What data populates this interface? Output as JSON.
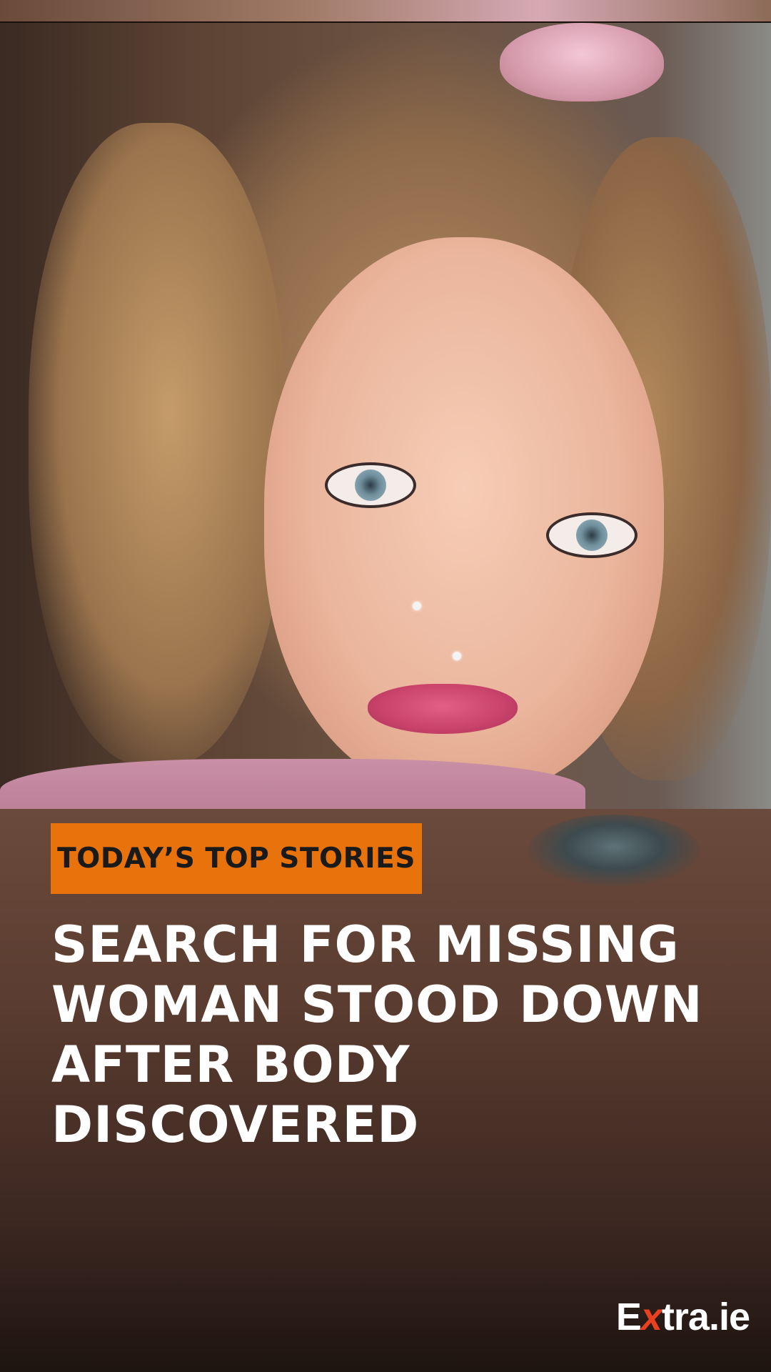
{
  "tag": {
    "label": "TODAY’S TOP STORIES"
  },
  "headline": {
    "lines": [
      "SEARCH FOR MISSING",
      "WOMAN STOOD DOWN",
      "AFTER BODY",
      "DISCOVERED"
    ]
  },
  "logo": {
    "part1": "E",
    "part2": "x",
    "part3": "tra.ie"
  },
  "colors": {
    "tag_bg": "#e8720c",
    "logo_x": "#e8411f",
    "headline_text": "#ffffff"
  }
}
